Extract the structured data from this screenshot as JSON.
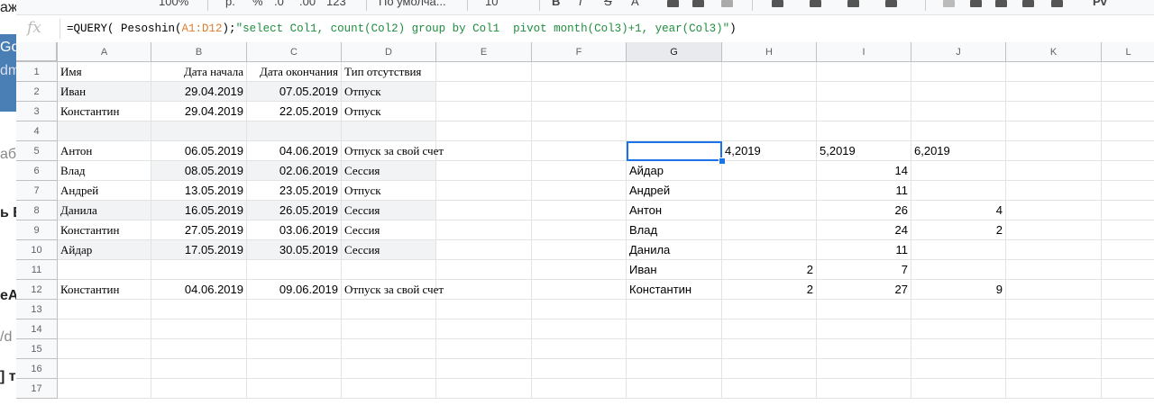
{
  "left_window": {
    "snippets": [
      "аж",
      "Go",
      "dm",
      "або",
      "ь Б",
      "еА",
      "/d",
      "] т"
    ]
  },
  "toolbar": {
    "zoom": "100%",
    "currency": "р.",
    "percent": "%",
    "decimals_less": ".0",
    "decimals_more": ".00",
    "more_formats": "123",
    "font": "По умолча...",
    "font_size": "10",
    "bold": "B",
    "italic": "I",
    "strike": "S",
    "text_color": "A",
    "functions": "Pv"
  },
  "formula_bar": {
    "fx": "fx",
    "prefix": "=QUERY( Pesoshin(",
    "range": "A1:D12",
    "middle": ");",
    "query": "\"select Col1, count(Col2) group by Col1  pivot month(Col3)+1, year(Col3)\"",
    "suffix": ")"
  },
  "columns": [
    "A",
    "B",
    "C",
    "D",
    "E",
    "F",
    "G",
    "H",
    "I",
    "J",
    "K",
    "L"
  ],
  "rows": [
    "1",
    "2",
    "3",
    "4",
    "5",
    "6",
    "7",
    "8",
    "9",
    "10",
    "11",
    "12",
    "13",
    "14",
    "15",
    "16",
    "17"
  ],
  "source_table": {
    "headers": [
      "Имя",
      "Дата начала",
      "Дата окончания",
      "Тип отсутствия"
    ],
    "rows": [
      [
        "Иван",
        "29.04.2019",
        "07.05.2019",
        "Отпуск"
      ],
      [
        "Константин",
        "29.04.2019",
        "22.05.2019",
        "Отпуск"
      ],
      [
        "",
        "",
        "",
        ""
      ],
      [
        "Антон",
        "06.05.2019",
        "04.06.2019",
        "Отпуск за свой счет"
      ],
      [
        "Влад",
        "08.05.2019",
        "02.06.2019",
        "Сессия"
      ],
      [
        "Андрей",
        "13.05.2019",
        "23.05.2019",
        "Отпуск"
      ],
      [
        "Данила",
        "16.05.2019",
        "26.05.2019",
        "Сессия"
      ],
      [
        "Константин",
        "27.05.2019",
        "03.06.2019",
        "Сессия"
      ],
      [
        "Айдар",
        "17.05.2019",
        "30.05.2019",
        "Сессия"
      ],
      [
        "",
        "",
        "",
        ""
      ],
      [
        "Константин",
        "04.06.2019",
        "09.06.2019",
        "Отпуск за свой счет"
      ]
    ]
  },
  "pivot_table": {
    "headers": [
      "",
      "4,2019",
      "5,2019",
      "6,2019"
    ],
    "rows": [
      [
        "Айдар",
        "",
        "14",
        ""
      ],
      [
        "Андрей",
        "",
        "11",
        ""
      ],
      [
        "Антон",
        "",
        "26",
        "4"
      ],
      [
        "Влад",
        "",
        "24",
        "2"
      ],
      [
        "Данила",
        "",
        "11",
        ""
      ],
      [
        "Иван",
        "2",
        "7",
        ""
      ],
      [
        "Константин",
        "2",
        "27",
        "9"
      ]
    ]
  },
  "colors": {
    "selection": "#1a73e8",
    "band": "#f1f3f4",
    "header_bg": "#f8f9fa"
  }
}
